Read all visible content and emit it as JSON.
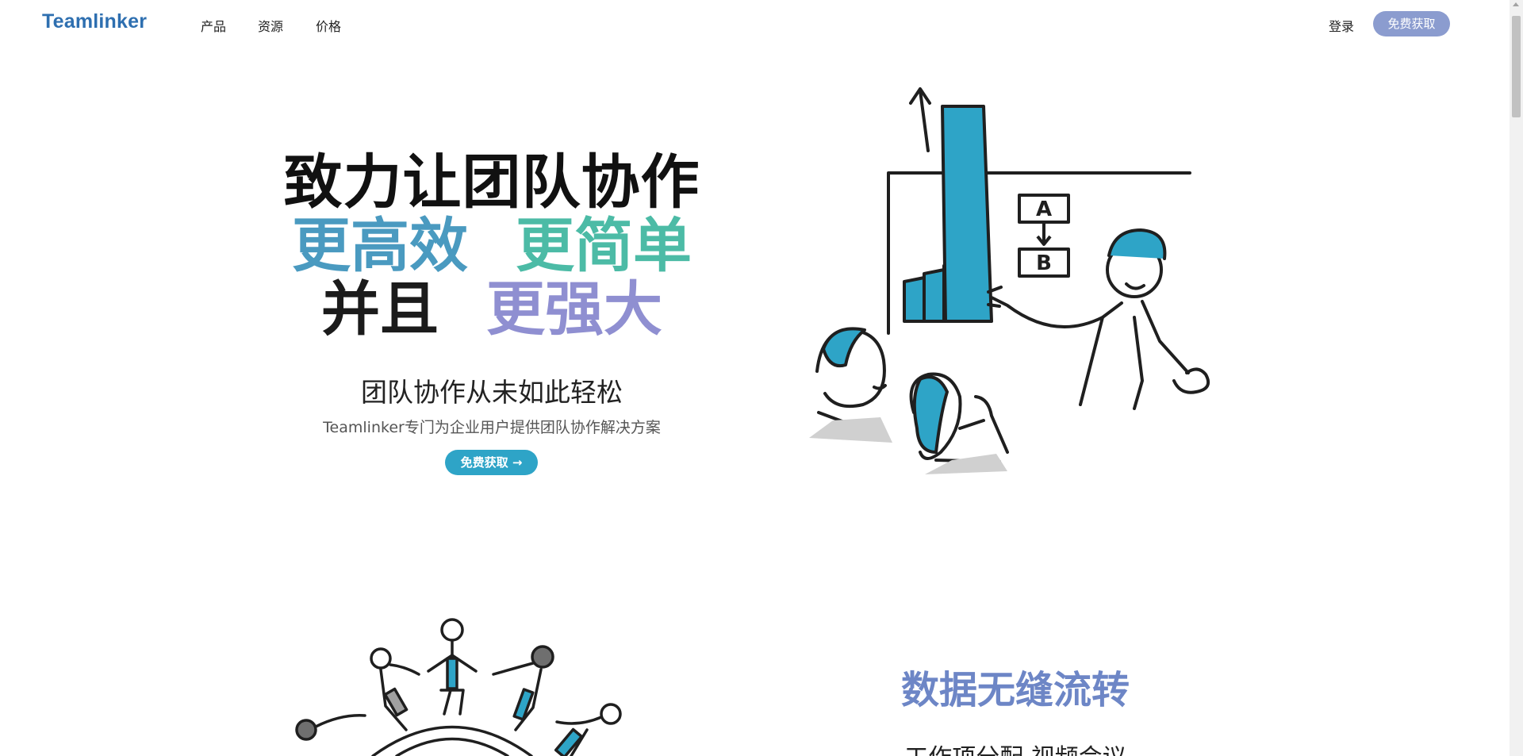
{
  "nav": {
    "brand": "Teamlinker",
    "links": [
      "产品",
      "资源",
      "价格"
    ],
    "login": "登录",
    "cta": "免费获取"
  },
  "hero": {
    "line1": "致力让团队协作",
    "line2a": "更高效",
    "line2b": "更简单",
    "line3a": "并且",
    "line3b": "更强大",
    "subtitle": "团队协作从未如此轻松",
    "description": "Teamlinker专门为企业用户提供团队协作解决方案",
    "cta": "免费获取 →",
    "colors": {
      "blue": "#4a9ac0",
      "teal": "#4cbba6",
      "purple": "#8f8fd1",
      "cta_bg": "#2ea4c7"
    }
  },
  "section2": {
    "title": "数据无缝流转",
    "subtitle": "工作项分配   视频会议"
  },
  "illustration": {
    "chart_labels": [
      "A",
      "B"
    ]
  },
  "icons": [
    "arrow-up-icon",
    "scroll-up-icon"
  ]
}
